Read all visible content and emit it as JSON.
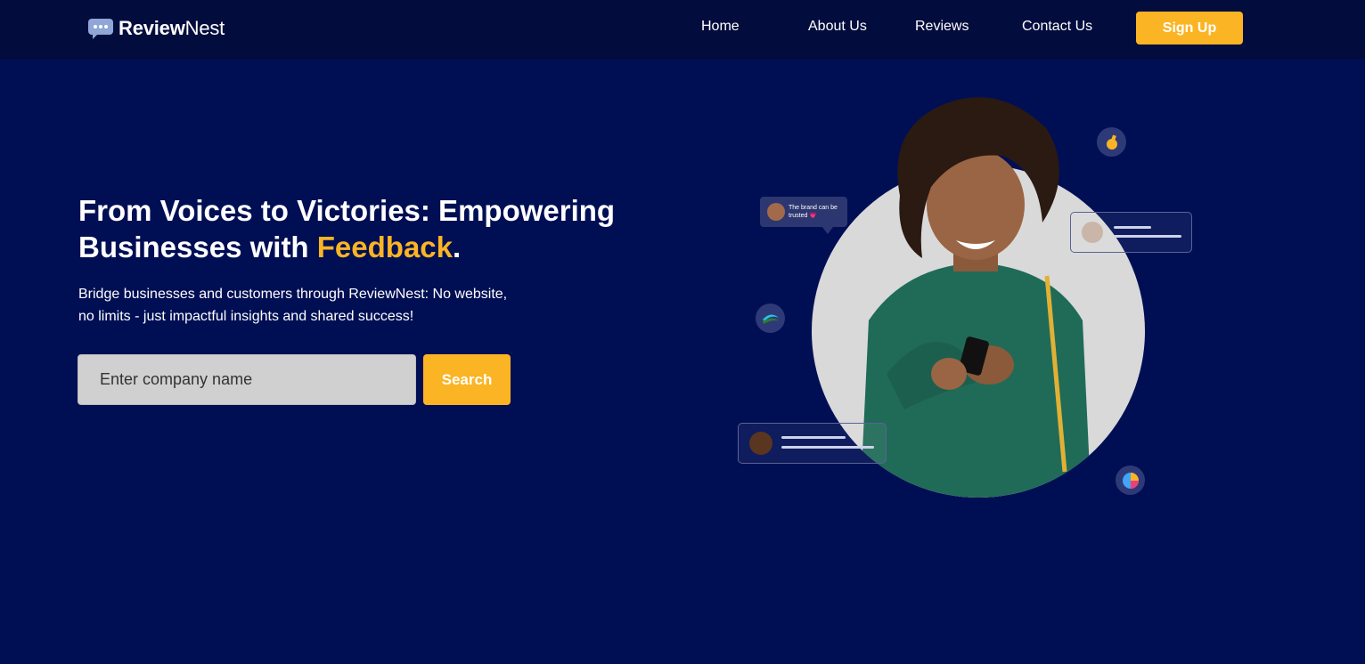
{
  "brand": {
    "name_bold": "Review",
    "name_regular": "Nest"
  },
  "nav": {
    "links": [
      "Home",
      "About Us",
      "Reviews",
      "Contact Us"
    ],
    "signup_label": "Sign Up"
  },
  "hero": {
    "title_line1": "From Voices to Victories: Empowering",
    "title_line2_prefix": "Businesses with ",
    "title_highlight": "Feedback",
    "title_suffix": ".",
    "subtitle": "Bridge businesses and customers through ReviewNest: No website, no limits - just impactful insights and shared success!",
    "search_placeholder": "Enter company name",
    "search_button": "Search"
  },
  "illustration": {
    "bubble_text": "The brand can be trusted 💗"
  },
  "colors": {
    "background": "#000f54",
    "navbar": "#030d3d",
    "accent": "#fbb423"
  }
}
